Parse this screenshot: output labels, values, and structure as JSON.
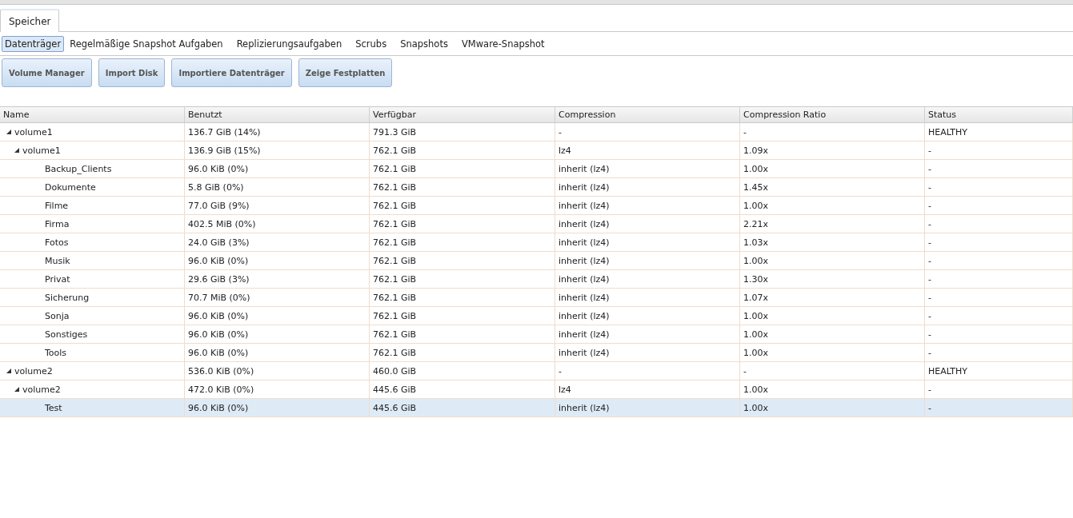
{
  "main_tabs": [
    {
      "label": "Speicher",
      "selected": true
    }
  ],
  "sub_tabs": [
    {
      "label": "Datenträger",
      "selected": true
    },
    {
      "label": "Regelmäßige Snapshot Aufgaben",
      "selected": false
    },
    {
      "label": "Replizierungsaufgaben",
      "selected": false
    },
    {
      "label": "Scrubs",
      "selected": false
    },
    {
      "label": "Snapshots",
      "selected": false
    },
    {
      "label": "VMware-Snapshot",
      "selected": false
    }
  ],
  "buttons": [
    "Volume Manager",
    "Import Disk",
    "Importiere Datenträger",
    "Zeige Festplatten"
  ],
  "table": {
    "columns": [
      "Name",
      "Benutzt",
      "Verfügbar",
      "Compression",
      "Compression Ratio",
      "Status"
    ],
    "rows": [
      {
        "name": "volume1",
        "used": "136.7 GiB (14%)",
        "available": "791.3 GiB",
        "compression": "-",
        "ratio": "-",
        "status": "HEALTHY",
        "expanded": true,
        "selected": false,
        "children": [
          {
            "name": "volume1",
            "used": "136.9 GiB (15%)",
            "available": "762.1 GiB",
            "compression": "lz4",
            "ratio": "1.09x",
            "status": "-",
            "expanded": true,
            "selected": false,
            "children": [
              {
                "name": "Backup_Clients",
                "used": "96.0 KiB (0%)",
                "available": "762.1 GiB",
                "compression": "inherit (lz4)",
                "ratio": "1.00x",
                "status": "-",
                "selected": false
              },
              {
                "name": "Dokumente",
                "used": "5.8 GiB (0%)",
                "available": "762.1 GiB",
                "compression": "inherit (lz4)",
                "ratio": "1.45x",
                "status": "-",
                "selected": false
              },
              {
                "name": "Filme",
                "used": "77.0 GiB (9%)",
                "available": "762.1 GiB",
                "compression": "inherit (lz4)",
                "ratio": "1.00x",
                "status": "-",
                "selected": false
              },
              {
                "name": "Firma",
                "used": "402.5 MiB (0%)",
                "available": "762.1 GiB",
                "compression": "inherit (lz4)",
                "ratio": "2.21x",
                "status": "-",
                "selected": false
              },
              {
                "name": "Fotos",
                "used": "24.0 GiB (3%)",
                "available": "762.1 GiB",
                "compression": "inherit (lz4)",
                "ratio": "1.03x",
                "status": "-",
                "selected": false
              },
              {
                "name": "Musik",
                "used": "96.0 KiB (0%)",
                "available": "762.1 GiB",
                "compression": "inherit (lz4)",
                "ratio": "1.00x",
                "status": "-",
                "selected": false
              },
              {
                "name": "Privat",
                "used": "29.6 GiB (3%)",
                "available": "762.1 GiB",
                "compression": "inherit (lz4)",
                "ratio": "1.30x",
                "status": "-",
                "selected": false
              },
              {
                "name": "Sicherung",
                "used": "70.7 MiB (0%)",
                "available": "762.1 GiB",
                "compression": "inherit (lz4)",
                "ratio": "1.07x",
                "status": "-",
                "selected": false
              },
              {
                "name": "Sonja",
                "used": "96.0 KiB (0%)",
                "available": "762.1 GiB",
                "compression": "inherit (lz4)",
                "ratio": "1.00x",
                "status": "-",
                "selected": false
              },
              {
                "name": "Sonstiges",
                "used": "96.0 KiB (0%)",
                "available": "762.1 GiB",
                "compression": "inherit (lz4)",
                "ratio": "1.00x",
                "status": "-",
                "selected": false
              },
              {
                "name": "Tools",
                "used": "96.0 KiB (0%)",
                "available": "762.1 GiB",
                "compression": "inherit (lz4)",
                "ratio": "1.00x",
                "status": "-",
                "selected": false
              }
            ]
          }
        ]
      },
      {
        "name": "volume2",
        "used": "536.0 KiB (0%)",
        "available": "460.0 GiB",
        "compression": "-",
        "ratio": "-",
        "status": "HEALTHY",
        "expanded": true,
        "selected": false,
        "children": [
          {
            "name": "volume2",
            "used": "472.0 KiB (0%)",
            "available": "445.6 GiB",
            "compression": "lz4",
            "ratio": "1.00x",
            "status": "-",
            "expanded": true,
            "selected": false,
            "children": [
              {
                "name": "Test",
                "used": "96.0 KiB (0%)",
                "available": "445.6 GiB",
                "compression": "inherit (lz4)",
                "ratio": "1.00x",
                "status": "-",
                "selected": true
              }
            ]
          }
        ]
      }
    ]
  }
}
